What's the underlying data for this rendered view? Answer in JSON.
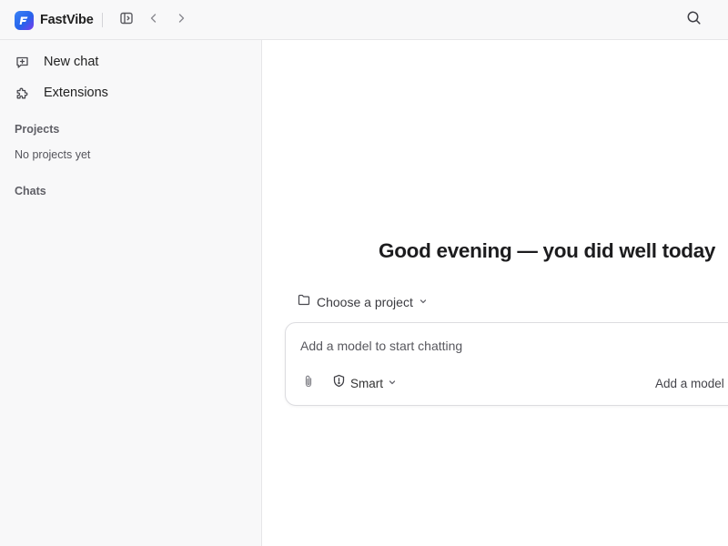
{
  "app": {
    "name": "FastVibe"
  },
  "topbar": {
    "toggle_sidebar_icon": "sidebar-toggle-icon",
    "back_icon": "chevron-left-icon",
    "forward_icon": "chevron-right-icon",
    "search_icon": "search-icon"
  },
  "sidebar": {
    "items": [
      {
        "label": "New chat",
        "icon": "chat-plus-icon"
      },
      {
        "label": "Extensions",
        "icon": "puzzle-icon"
      }
    ],
    "projects": {
      "title": "Projects",
      "empty": "No projects yet"
    },
    "chats": {
      "title": "Chats"
    }
  },
  "main": {
    "greeting": "Good evening — you did well today",
    "project_select": {
      "label": "Choose a project"
    },
    "composer": {
      "placeholder": "Add a model to start chatting",
      "mode_label": "Smart",
      "add_model_label": "Add a model"
    }
  },
  "colors": {
    "accent": "#2563eb",
    "sidebar_bg": "#f8f8f9",
    "border": "#e6e6e8"
  }
}
